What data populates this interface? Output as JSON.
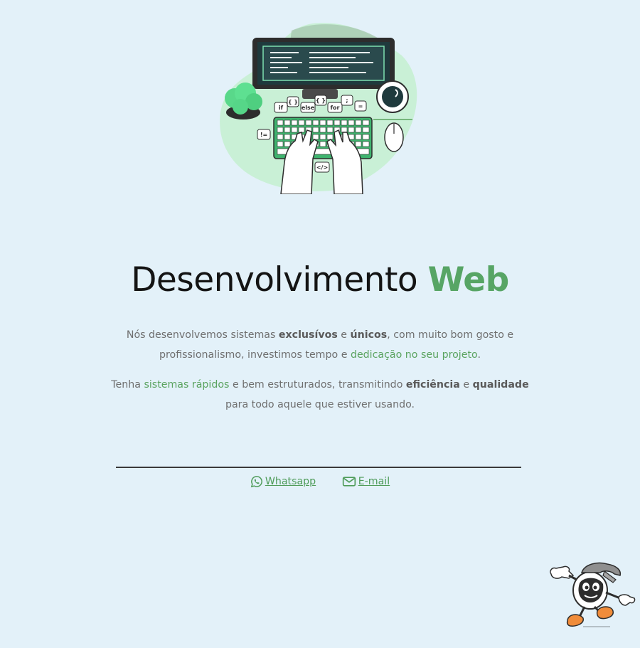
{
  "title": {
    "main": "Desenvolvimento",
    "accent": "Web"
  },
  "paragraph1": {
    "t1": "Nós desenvolvemos sistemas ",
    "b1": "exclusívos",
    "t2": " e ",
    "b2": "únicos",
    "t3": ", com muito bom gosto e profissionalismo, investimos tempo e ",
    "g1": "dedicação no seu projeto",
    "t4": "."
  },
  "paragraph2": {
    "t1": "Tenha ",
    "g1": "sistemas rápidos",
    "t2": " e bem estruturados, transmitindo ",
    "b1": "eficiência",
    "t3": " e ",
    "b2": "qualidade",
    "t4": " para todo aquele que estiver usando."
  },
  "contact": {
    "whatsapp_label": "Whatsapp",
    "email_label": "E-mail"
  },
  "illustration": {
    "code_tags": [
      "if",
      "{ }",
      "else",
      "{ }",
      "for",
      ";",
      "=",
      "!=",
      "</>"
    ]
  },
  "colors": {
    "background": "#e3f1f9",
    "accent_green": "#57a565",
    "title_text": "#141414",
    "body_text": "#6f6f6f",
    "divider": "#3a3a3a"
  },
  "icons": {
    "whatsapp": "whatsapp-icon",
    "email": "envelope-icon"
  }
}
